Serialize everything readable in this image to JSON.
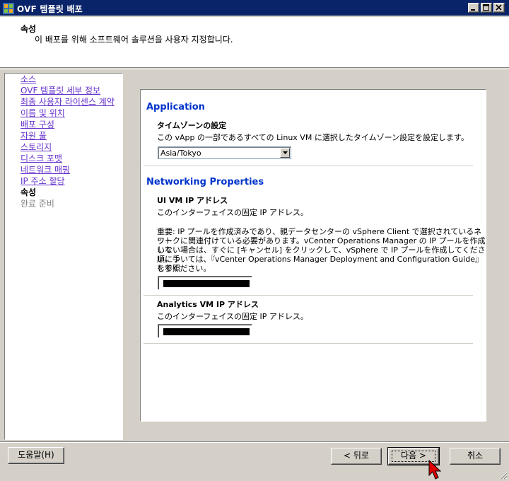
{
  "window": {
    "title": "OVF 템플릿 배포",
    "icon": "vsphere-app-icon",
    "controls": [
      "minimize",
      "maximize",
      "close"
    ]
  },
  "header": {
    "title": "속성",
    "subtitle": "이 배포를 위해 소프트웨어 솔루션을 사용자 지정합니다."
  },
  "nav": {
    "items": [
      {
        "label": "소스",
        "state": "link"
      },
      {
        "label": "OVF 템플릿 세부 정보",
        "state": "link"
      },
      {
        "label": "최종 사용자 라이센스 계약",
        "state": "link"
      },
      {
        "label": "이름 및 위치",
        "state": "link"
      },
      {
        "label": "배포 구성",
        "state": "link"
      },
      {
        "label": "자원 풀",
        "state": "link"
      },
      {
        "label": "스토리지",
        "state": "link"
      },
      {
        "label": "디스크 포맷",
        "state": "link"
      },
      {
        "label": "네트워크 매핑",
        "state": "link"
      },
      {
        "label": "IP 주소 할당",
        "state": "link"
      },
      {
        "label": "속성",
        "state": "current"
      },
      {
        "label": "완료 준비",
        "state": "disabled"
      }
    ]
  },
  "application": {
    "section_title": "Application",
    "timezone_label": "タイムゾーンの設定",
    "timezone_desc": "この vApp の一部であるすべての Linux VM に選択したタイムゾーン設定を設定します。",
    "timezone_value": "Asia/Tokyo"
  },
  "networking": {
    "section_title": "Networking Properties",
    "ui_vm_label": "UI VM IP アドレス",
    "ui_vm_desc": "このインターフェイスの固定 IP アドレス。",
    "note_lines": [
      "重要: IP プールを作成済みであり、親データセンターの vSphere Client で選択されているネット",
      "ワークに関連付けている必要があります。vCenter Operations Manager の IP プールを作成して",
      "いない場合は、すぐに [キャンセル] をクリックして、vSphere で IP プールを作成してください。手",
      "順については、『vCenter Operations Manager Deployment and Configuration Guide』を参照",
      "してください。"
    ],
    "ui_vm_ip": "",
    "analytics_vm_label": "Analytics VM IP アドレス",
    "analytics_vm_desc": "このインターフェイスの固定 IP アドレス。",
    "analytics_vm_ip": ""
  },
  "footer": {
    "help_label": "도움말(H)",
    "back_label": "< 뒤로",
    "next_label": "다음 >",
    "cancel_label": "취소"
  },
  "colors": {
    "title_bar": "#0a246a",
    "section_heading": "#0033cc",
    "nav_link": "#6633cc",
    "face": "#d4d0c8"
  }
}
